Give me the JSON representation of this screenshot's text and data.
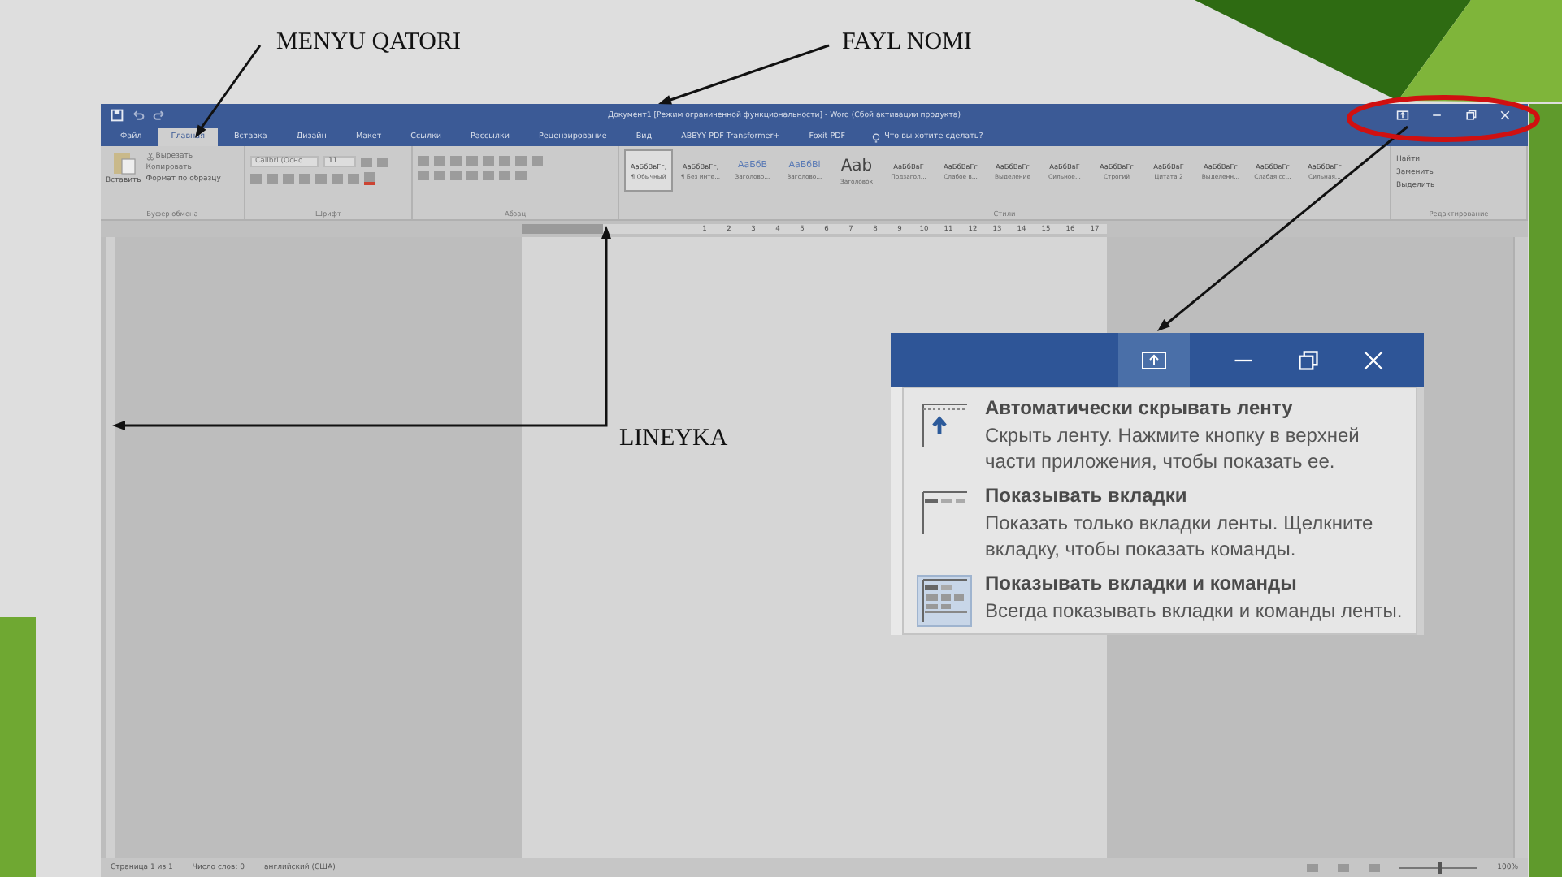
{
  "annotations": [
    {
      "label": "MENYU QATORI",
      "kind": "menu"
    },
    {
      "label": "FAYL NOMI",
      "kind": "title"
    },
    {
      "label": "LINEYKA",
      "kind": "ruler"
    }
  ],
  "word_window": {
    "title": "Документ1 [Режим ограниченной функциональности] - Word (Сбой активации продукта)",
    "tabs": [
      {
        "label": "Файл",
        "selected": false
      },
      {
        "label": "Главная",
        "selected": true
      },
      {
        "label": "Вставка",
        "selected": false
      },
      {
        "label": "Дизайн",
        "selected": false
      },
      {
        "label": "Макет",
        "selected": false
      },
      {
        "label": "Ссылки",
        "selected": false
      },
      {
        "label": "Рассылки",
        "selected": false
      },
      {
        "label": "Рецензирование",
        "selected": false
      },
      {
        "label": "Вид",
        "selected": false
      },
      {
        "label": "ABBYY PDF Transformer+",
        "selected": false
      },
      {
        "label": "Foxit PDF",
        "selected": false
      }
    ],
    "search_placeholder": "Что вы хотите сделать?",
    "clipboard": {
      "paste": "Вставить",
      "cut": "Вырезать",
      "copy": "Копировать",
      "format_painter": "Формат по образцу",
      "group": "Буфер обмена"
    },
    "font": {
      "name": "Calibri (Осно",
      "size": "11",
      "group": "Шрифт"
    },
    "paragraph_group": "Абзац",
    "styles": [
      {
        "sample": "АаБбВвГг,",
        "name": "¶ Обычный",
        "kind": "normal",
        "selected": true
      },
      {
        "sample": "АаБбВвГг,",
        "name": "¶ Без инте...",
        "kind": "normal",
        "selected": false
      },
      {
        "sample": "АаБбВ",
        "name": "Заголово...",
        "kind": "heading",
        "selected": false
      },
      {
        "sample": "АаБбВі",
        "name": "Заголово...",
        "kind": "heading",
        "selected": false
      },
      {
        "sample": "Аab",
        "name": "Заголовок",
        "kind": "large",
        "selected": false
      },
      {
        "sample": "АаБбВвГ",
        "name": "Подзагол...",
        "kind": "normal",
        "selected": false
      },
      {
        "sample": "АаБбВвГг",
        "name": "Слабое в...",
        "kind": "normal",
        "selected": false
      },
      {
        "sample": "АаБбВвГг",
        "name": "Выделение",
        "kind": "normal",
        "selected": false
      },
      {
        "sample": "АаБбВвГ",
        "name": "Сильное...",
        "kind": "normal",
        "selected": false
      },
      {
        "sample": "АаБбВвГг",
        "name": "Строгий",
        "kind": "normal",
        "selected": false
      },
      {
        "sample": "АаБбВвГ",
        "name": "Цитата 2",
        "kind": "normal",
        "selected": false
      },
      {
        "sample": "АаБбВвГг",
        "name": "Выделенн...",
        "kind": "normal",
        "selected": false
      },
      {
        "sample": "АаБбВвГг",
        "name": "Слабая сс...",
        "kind": "normal",
        "selected": false
      },
      {
        "sample": "АаБбВвГг",
        "name": "Сильная...",
        "kind": "normal",
        "selected": false
      }
    ],
    "styles_group": "Стили",
    "editing": {
      "items": [
        "Найти",
        "Заменить",
        "Выделить"
      ],
      "group": "Редактирование"
    },
    "ruler_numbers": [
      "1",
      "2",
      "3",
      "4",
      "5",
      "6",
      "7",
      "8",
      "9",
      "10",
      "11",
      "12",
      "13",
      "14",
      "15",
      "16",
      "17"
    ],
    "status_bar": {
      "page": "Страница 1 из 1",
      "words": "Число слов: 0",
      "language": "английский (США)",
      "zoom": "100%",
      "zoom_slider": {
        "level": 0.5
      }
    }
  },
  "ribbon_display_popup": {
    "items": [
      {
        "kind": "autohide",
        "title": "Автоматически скрывать ленту",
        "description": "Скрыть ленту. Нажмите кнопку в верхней части приложения, чтобы показать ее.",
        "selected": false
      },
      {
        "kind": "tabs",
        "title": "Показывать вкладки",
        "description": "Показать только вкладки ленты. Щелкните вкладку, чтобы показать команды.",
        "selected": false
      },
      {
        "kind": "tabs_commands",
        "title": "Показывать вкладки и команды",
        "description": "Всегда показывать вкладки и команды ленты.",
        "selected": true
      }
    ]
  }
}
